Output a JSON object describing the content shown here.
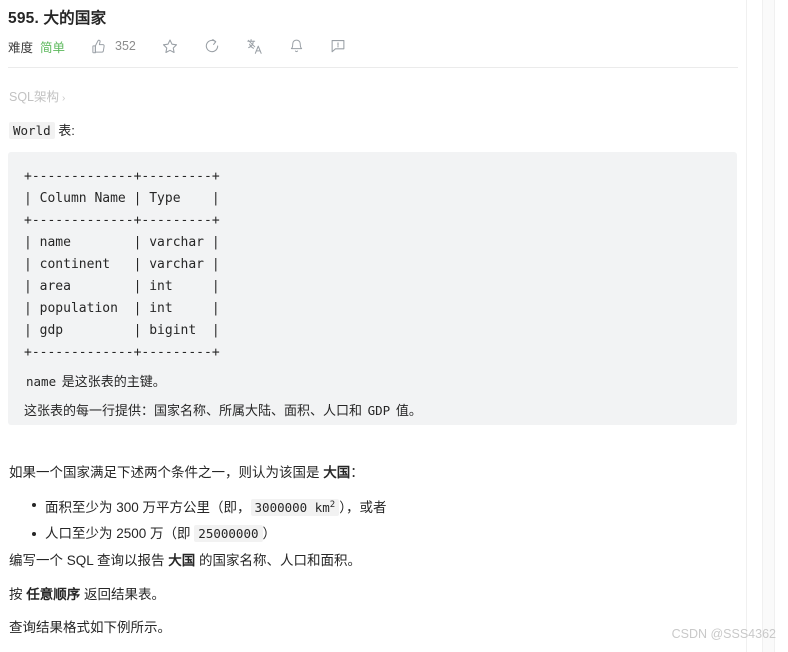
{
  "header": {
    "title": "595. 大的国家",
    "difficulty_label": "难度",
    "difficulty_value": "简单",
    "like_count": "352",
    "difficulty_color": "#5cb85c",
    "icons": {
      "like": "thumbs-up-icon",
      "star": "star-icon",
      "share": "share-icon",
      "translate": "translate-icon",
      "bell": "bell-icon",
      "comment": "comment-icon"
    }
  },
  "breadcrumb": {
    "label": "SQL架构",
    "chevron": "›"
  },
  "schema": {
    "table_prefix_code": "World",
    "table_suffix": " 表:",
    "ascii_table": "+-------------+---------+\n| Column Name | Type    |\n+-------------+---------+\n| name        | varchar |\n| continent   | varchar |\n| area        | int     |\n| population  | int     |\n| gdp         | bigint  |\n+-------------+---------+",
    "note_line1_code": "name",
    "note_line1_text": " 是这张表的主键。",
    "note_line2_prefix": "这张表的每一行提供：国家名称、所属大陆、面积、人口和 ",
    "note_line2_code": "GDP",
    "note_line2_suffix": " 值。"
  },
  "description": {
    "condition_intro_a": "如果一个国家满足下述两个条件之一，则认为该国是 ",
    "condition_intro_bold": "大国",
    "condition_intro_b": "：",
    "bullets": [
      {
        "text_a": "面积至少为 300 万平方公里（即，",
        "code_value": "3000000 km",
        "code_sup": "2",
        "text_b": "），或者"
      },
      {
        "text_a": "人口至少为 2500 万（即 ",
        "code_value": "25000000",
        "code_sup": "",
        "text_b": "）"
      }
    ],
    "write_query_a": "编写一个 SQL 查询以报告 ",
    "write_query_bold": "大国",
    "write_query_b": " 的国家名称、人口和面积。",
    "order_a": "按 ",
    "order_bold": "任意顺序",
    "order_b": " 返回结果表。",
    "format_line": "查询结果格式如下例所示。"
  },
  "watermark": {
    "text": "CSDN @SSS4362"
  }
}
